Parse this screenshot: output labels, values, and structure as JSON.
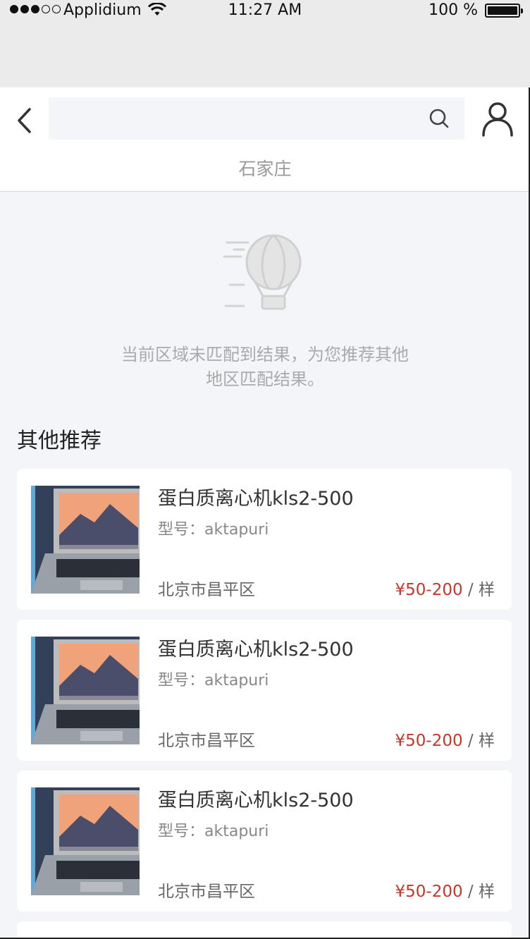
{
  "status_bar": {
    "carrier": "Applidium",
    "time": "11:27 AM",
    "battery": "100 %"
  },
  "header": {
    "search_placeholder": "",
    "location": "石家庄"
  },
  "empty_state": {
    "line1": "当前区域未匹配到结果，为您推荐其他",
    "line2": "地区匹配结果。"
  },
  "section_title": "其他推荐",
  "products": [
    {
      "title": "蛋白质离心机kls2-500",
      "model": "型号：aktapuri",
      "location": "北京市昌平区",
      "price": "¥50-200",
      "unit": " / 样"
    },
    {
      "title": "蛋白质离心机kls2-500",
      "model": "型号：aktapuri",
      "location": "北京市昌平区",
      "price": "¥50-200",
      "unit": " / 样"
    },
    {
      "title": "蛋白质离心机kls2-500",
      "model": "型号：aktapuri",
      "location": "北京市昌平区",
      "price": "¥50-200",
      "unit": " / 样"
    }
  ],
  "colors": {
    "price": "#c0392b",
    "background": "#f4f5f9"
  }
}
